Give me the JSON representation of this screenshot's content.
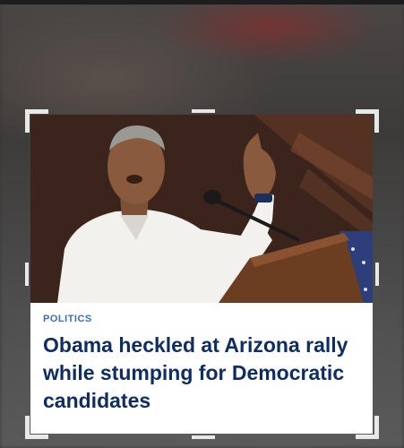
{
  "article": {
    "category": "POLITICS",
    "headline": "Obama heckled at Arizona rally while stumping for Democratic candidates"
  },
  "colors": {
    "category": "#3b6fb6",
    "headline": "#0f2d63",
    "card_background": "#ffffff",
    "crop_handles": "#e8e8e8"
  },
  "icons": {
    "crop_frame": "crop-corner-handles"
  }
}
